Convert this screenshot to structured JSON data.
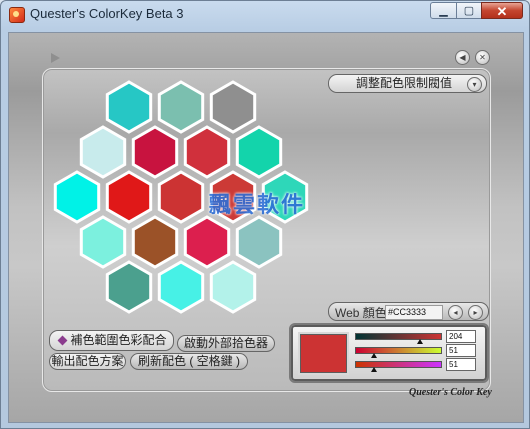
{
  "window": {
    "title": "Quester's ColorKey Beta 3",
    "min_glyph": "▁",
    "max_glyph": "▢",
    "close_glyph": "✕"
  },
  "panel": {
    "threshold_label": "調整配色限制閥值",
    "web_color_label": "Web 顏色",
    "web_color_value": "#CC3333",
    "buttons": {
      "complement": "補色範圍色彩配合",
      "external_picker": "啟動外部拾色器",
      "export_scheme": "輸出配色方案",
      "refresh_scheme": "刷新配色 ( 空格鍵 )"
    },
    "brand": "Quester's Color Key",
    "watermark": "飄雲軟件"
  },
  "color": {
    "r": 204,
    "g": 51,
    "b": 51,
    "r_text": "204",
    "g_text": "51",
    "b_text": "51",
    "swatch": "#cc3333"
  },
  "hex_colors": {
    "row1": [
      "#26c7c5",
      "#7bbfaf",
      "#8f8f8f"
    ],
    "row2": [
      "#c8ebec",
      "#c8133f",
      "#d0303c",
      "#13d4ab"
    ],
    "row3": [
      "#00f2e7",
      "#e01818",
      "#cc3333",
      "#cc3a36",
      "#2ed7b9"
    ],
    "row4": [
      "#7cf0de",
      "#9b5228",
      "#dc1f4e",
      "#8bc3c0"
    ],
    "row5": [
      "#4ba08e",
      "#47f1e6",
      "#b3f2ea"
    ]
  }
}
